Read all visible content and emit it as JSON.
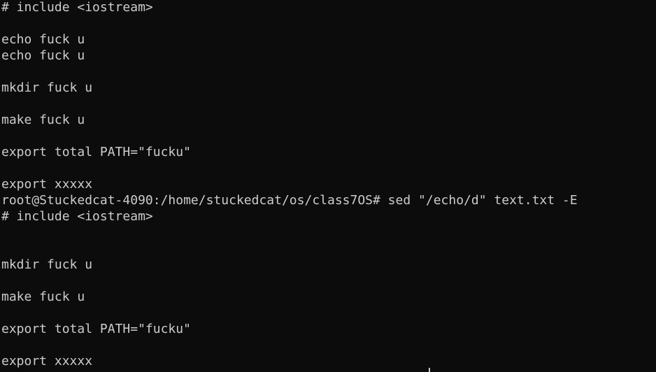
{
  "terminal": {
    "background": "#0c0c0c",
    "foreground": "#cccccc",
    "lines": [
      "# include <iostream>",
      "",
      "echo fuck u",
      "echo fuck u",
      "",
      "mkdir fuck u",
      "",
      "make fuck u",
      "",
      "export total PATH=\"fucku\"",
      "",
      "export xxxxx",
      "root@Stuckedcat-4090:/home/stuckedcat/os/class7OS# sed \"/echo/d\" text.txt -E",
      "# include <iostream>",
      "",
      "",
      "mkdir fuck u",
      "",
      "make fuck u",
      "",
      "export total PATH=\"fucku\"",
      "",
      "export xxxxx"
    ]
  }
}
